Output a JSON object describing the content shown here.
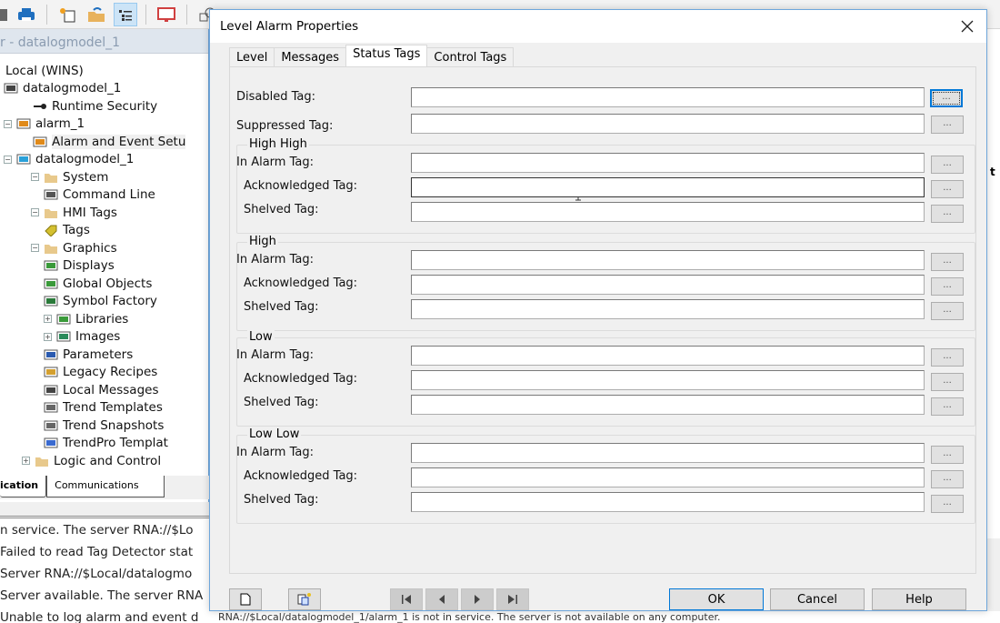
{
  "toolbar": {
    "icons": [
      "save-icon",
      "print-icon",
      "new-icon",
      "open-folder-icon",
      "explorer-view-icon",
      "display-icon",
      "network-icon",
      "misc-icon",
      "alarm-icon",
      "window-icon"
    ]
  },
  "explorer": {
    "title": "r - datalogmodel_1",
    "tree": [
      {
        "label": "Local (WINS)",
        "icon": "computer-icon",
        "level": 0,
        "toggle": ""
      },
      {
        "label": "datalogmodel_1",
        "icon": "server-gear-icon",
        "level": 0,
        "toggle": ""
      },
      {
        "label": "Runtime Security",
        "icon": "key-icon",
        "level": 1,
        "toggle": ""
      },
      {
        "label": "alarm_1",
        "icon": "alarm-server-icon",
        "level": 0,
        "toggle": "-"
      },
      {
        "label": "Alarm and Event Setu",
        "icon": "alarm-setup-icon",
        "level": 1,
        "toggle": "",
        "selected": true
      },
      {
        "label": "datalogmodel_1",
        "icon": "hmi-server-icon",
        "level": 0,
        "toggle": "-"
      },
      {
        "label": "System",
        "icon": "folder-icon",
        "level": 1,
        "toggle": "-"
      },
      {
        "label": "Command Line",
        "icon": "command-line-icon",
        "level": 2,
        "toggle": ""
      },
      {
        "label": "HMI Tags",
        "icon": "folder-icon",
        "level": 1,
        "toggle": "-"
      },
      {
        "label": "Tags",
        "icon": "tag-icon",
        "level": 2,
        "toggle": ""
      },
      {
        "label": "Graphics",
        "icon": "folder-icon",
        "level": 1,
        "toggle": "-"
      },
      {
        "label": "Displays",
        "icon": "display-graphic-icon",
        "level": 2,
        "toggle": ""
      },
      {
        "label": "Global Objects",
        "icon": "display-graphic-icon",
        "level": 2,
        "toggle": ""
      },
      {
        "label": "Symbol Factory",
        "icon": "symbol-factory-icon",
        "level": 2,
        "toggle": ""
      },
      {
        "label": "Libraries",
        "icon": "display-graphic-icon",
        "level": 2,
        "toggle": "+"
      },
      {
        "label": "Images",
        "icon": "image-icon",
        "level": 2,
        "toggle": "+"
      },
      {
        "label": "Parameters",
        "icon": "parameters-icon",
        "level": 2,
        "toggle": ""
      },
      {
        "label": "Legacy Recipes",
        "icon": "recipe-icon",
        "level": 2,
        "toggle": ""
      },
      {
        "label": "Local Messages",
        "icon": "message-icon",
        "level": 2,
        "toggle": ""
      },
      {
        "label": "Trend Templates",
        "icon": "trend-icon",
        "level": 2,
        "toggle": ""
      },
      {
        "label": "Trend Snapshots",
        "icon": "trend-snapshot-icon",
        "level": 2,
        "toggle": ""
      },
      {
        "label": "TrendPro Templat",
        "icon": "trendpro-icon",
        "level": 2,
        "toggle": ""
      },
      {
        "label": "Logic and Control",
        "icon": "folder-icon",
        "level": 1,
        "toggle": "+"
      }
    ],
    "tabs": [
      "ication",
      "Communications"
    ]
  },
  "diagnostics": [
    "n service. The server RNA://$Lo",
    "Failed to read Tag Detector stat",
    "Server RNA://$Local/datalogmo",
    "Server available. The server RNA",
    "Unable to log alarm and event d"
  ],
  "bottom_status": "RNA://$Local/datalogmodel_1/alarm_1 is not in service. The server is not available on any computer.",
  "right_fragment": "t",
  "dialog": {
    "title": "Level Alarm Properties",
    "close_label": "✕",
    "tabs": [
      {
        "label": "Level",
        "active": false
      },
      {
        "label": "Messages",
        "active": false
      },
      {
        "label": "Status Tags",
        "active": true
      },
      {
        "label": "Control Tags",
        "active": false
      }
    ],
    "top_fields": [
      {
        "label": "Disabled Tag:",
        "value": ""
      },
      {
        "label": "Suppressed Tag:",
        "value": ""
      }
    ],
    "groups": [
      {
        "title": "High High",
        "fields": [
          {
            "label": "In Alarm Tag:",
            "value": ""
          },
          {
            "label": "Acknowledged Tag:",
            "value": ""
          },
          {
            "label": "Shelved Tag:",
            "value": ""
          }
        ]
      },
      {
        "title": "High",
        "fields": [
          {
            "label": "In Alarm Tag:",
            "value": ""
          },
          {
            "label": "Acknowledged Tag:",
            "value": ""
          },
          {
            "label": "Shelved Tag:",
            "value": ""
          }
        ]
      },
      {
        "title": "Low",
        "fields": [
          {
            "label": "In Alarm Tag:",
            "value": ""
          },
          {
            "label": "Acknowledged Tag:",
            "value": ""
          },
          {
            "label": "Shelved Tag:",
            "value": ""
          }
        ]
      },
      {
        "title": "Low Low",
        "fields": [
          {
            "label": "In Alarm Tag:",
            "value": ""
          },
          {
            "label": "Acknowledged Tag:",
            "value": ""
          },
          {
            "label": "Shelved Tag:",
            "value": ""
          }
        ]
      }
    ],
    "browse_label": "...",
    "footer": {
      "new_icon": "new-document-icon",
      "copy_icon": "copy-new-icon",
      "nav_first": "first-record-icon",
      "nav_prev": "previous-record-icon",
      "nav_next": "next-record-icon",
      "nav_last": "last-record-icon",
      "ok_label": "OK",
      "cancel_label": "Cancel",
      "help_label": "Help"
    }
  },
  "colors": {
    "accent": "#0078d7",
    "dialog_border": "#6ea6db",
    "button_face": "#e1e1e1"
  }
}
